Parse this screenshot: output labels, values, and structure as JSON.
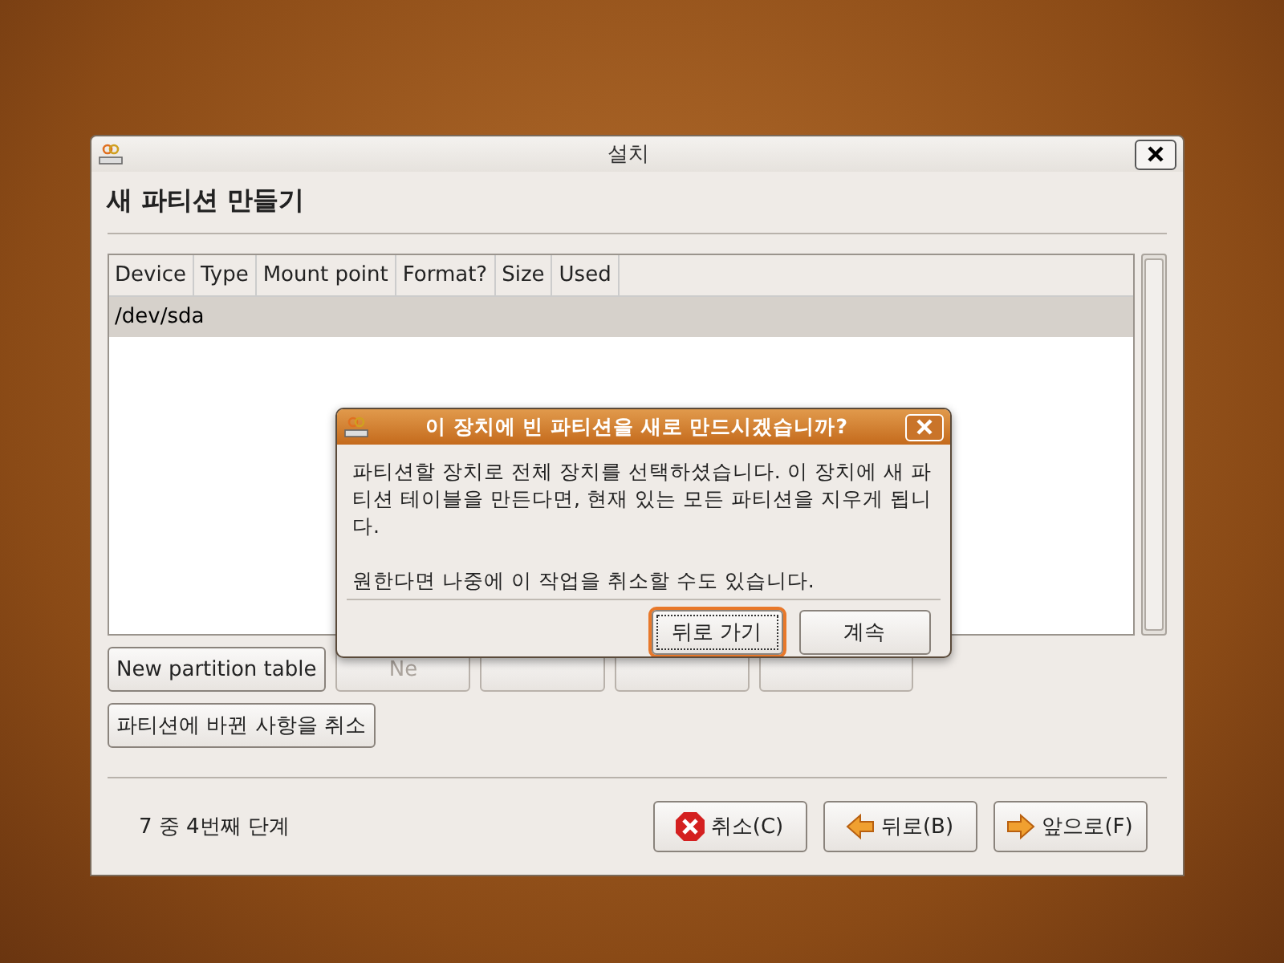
{
  "window": {
    "title": "설치"
  },
  "heading": "새 파티션 만들기",
  "table": {
    "columns": [
      "Device",
      "Type",
      "Mount point",
      "Format?",
      "Size",
      "Used"
    ],
    "rows": [
      {
        "cells": [
          "/dev/sda"
        ],
        "selected": true
      }
    ]
  },
  "partition_buttons": [
    {
      "label": "New partition table",
      "disabled": false
    },
    {
      "label": "Ne",
      "disabled": true
    },
    {
      "disabled": true
    },
    {
      "disabled": true
    },
    {
      "disabled": true
    }
  ],
  "revert_button": "파티션에 바뀐 사항을 취소",
  "step": "7 중 4번째 단계",
  "footer_buttons": [
    {
      "kind": "cancel",
      "label": "취소(C)"
    },
    {
      "kind": "back",
      "label": "뒤로(B)"
    },
    {
      "kind": "forward",
      "label": "앞으로(F)"
    }
  ],
  "dialog": {
    "title": "이 장치에 빈 파티션을 새로 만드시겠습니까?",
    "paragraphs": [
      "파티션할 장치로 전체 장치를 선택하셨습니다. 이 장치에 새 파티션 테이블을 만든다면, 현재 있는 모든 파티션을 지우게 됩니다.",
      "원한다면 나중에 이 작업을 취소할 수도 있습니다."
    ],
    "buttons": [
      {
        "label": "뒤로 가기",
        "selected": true
      },
      {
        "label": "계속",
        "selected": false
      }
    ]
  }
}
